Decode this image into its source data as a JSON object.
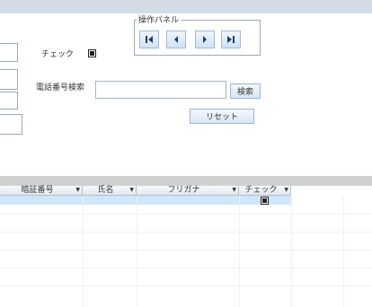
{
  "form": {
    "check_label": "チェック",
    "phone_search_label": "電話番号検索",
    "phone_search_placeholder": "",
    "search_button": "検索",
    "reset_button": "リセット"
  },
  "nav_panel": {
    "title": "操作パネル",
    "first_icon": "first-record-icon",
    "prev_icon": "previous-record-icon",
    "next_icon": "next-record-icon",
    "last_icon": "last-record-icon"
  },
  "grid": {
    "columns": [
      "暗証番号",
      "氏名",
      "フリガナ",
      "チェック"
    ],
    "selected_row_checked": true
  },
  "colors": {
    "header_bar": "#d3dbe6",
    "nav_button": "#cfe2f6",
    "selected_row": "#cfe6f8",
    "divider": "#d0d0d0"
  }
}
